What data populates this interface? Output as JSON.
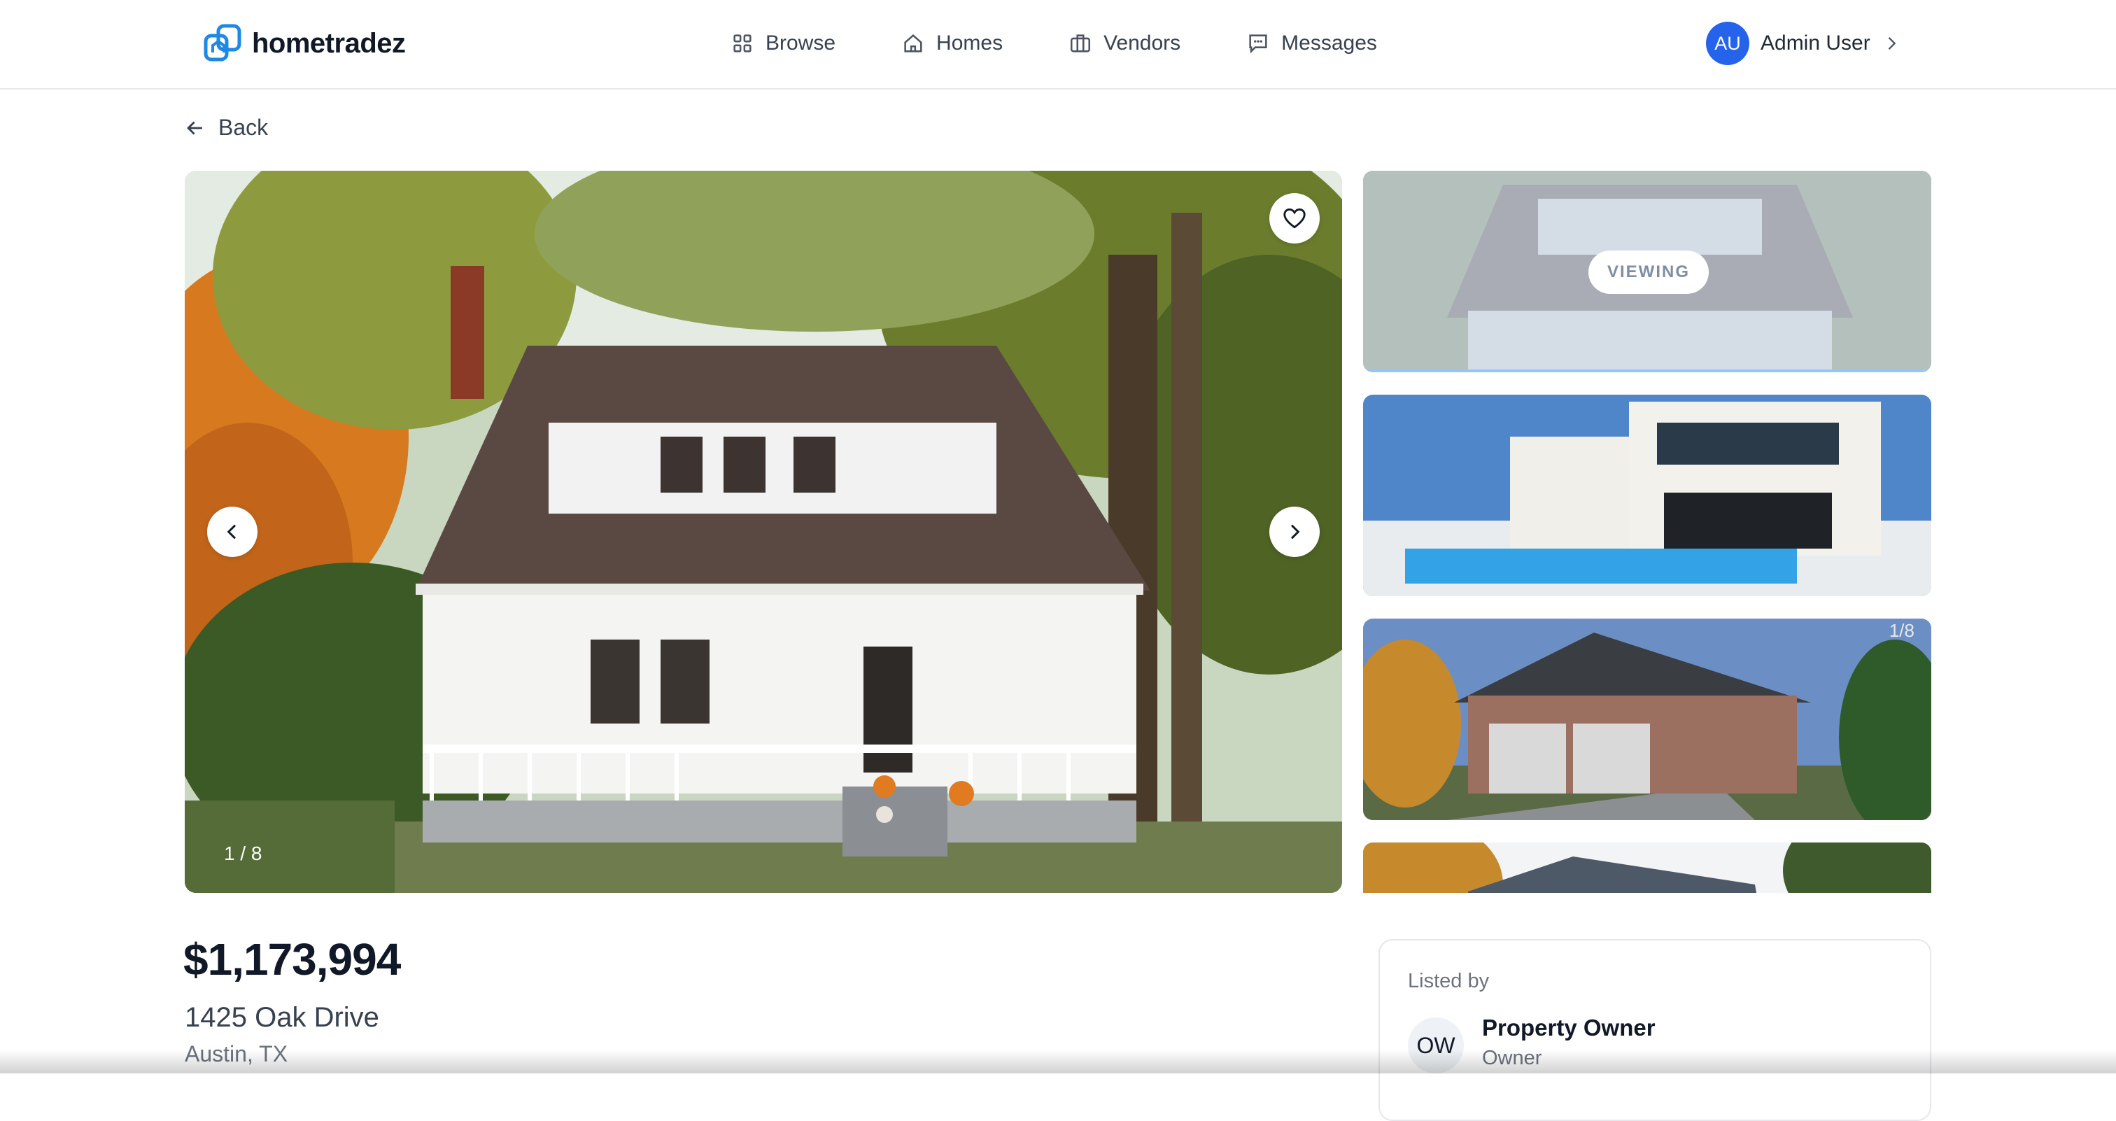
{
  "header": {
    "brand": "hometradez",
    "nav": [
      {
        "label": "Browse",
        "icon": "grid-icon"
      },
      {
        "label": "Homes",
        "icon": "home-icon"
      },
      {
        "label": "Vendors",
        "icon": "briefcase-icon"
      },
      {
        "label": "Messages",
        "icon": "message-icon"
      }
    ],
    "user": {
      "initials": "AU",
      "name": "Admin User"
    }
  },
  "back_label": "Back",
  "gallery": {
    "counter": "1 / 8",
    "viewing_label": "VIEWING",
    "thumb_counter": "1/8"
  },
  "listing": {
    "price": "$1,173,994",
    "address": "1425 Oak Drive",
    "city": "Austin, TX"
  },
  "listed_by": {
    "label": "Listed by",
    "initials": "OW",
    "name": "Property Owner",
    "role": "Owner"
  },
  "colors": {
    "accent": "#2563eb",
    "brand": "#1e88e5"
  }
}
